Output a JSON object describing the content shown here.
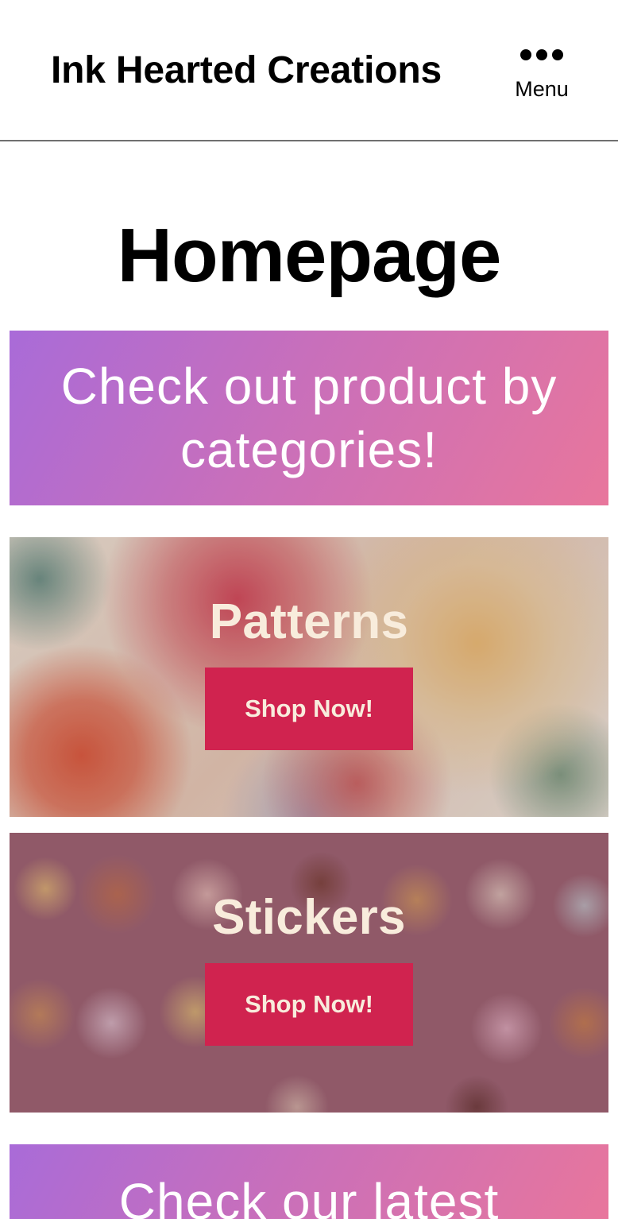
{
  "header": {
    "site_title": "Ink Hearted Creations",
    "menu_label": "Menu"
  },
  "main": {
    "page_title": "Homepage",
    "categories_banner": "Check out product by categories!",
    "categories": [
      {
        "title": "Patterns",
        "button_label": "Shop Now!"
      },
      {
        "title": "Stickers",
        "button_label": "Shop Now!"
      }
    ],
    "latest_banner": "Check our latest"
  },
  "colors": {
    "button": "#d0234f",
    "gradient_start": "#a96bd8",
    "gradient_end": "#e8769c",
    "card_text": "#f8ecdc"
  },
  "icons": {
    "menu": "more-horizontal-icon"
  }
}
